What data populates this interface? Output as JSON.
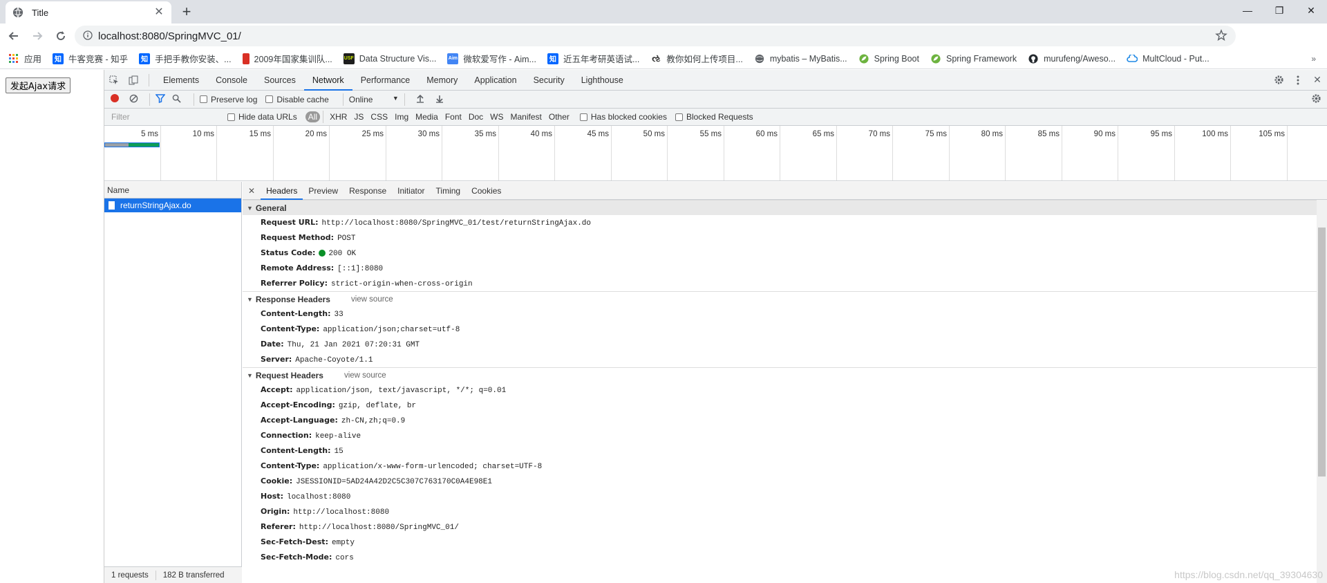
{
  "browser": {
    "tab_title": "Title",
    "url": "localhost:8080/SpringMVC_01/"
  },
  "bookmarks": [
    {
      "label": "应用",
      "icon": "apps-grid-icon",
      "color": "#ea4335"
    },
    {
      "label": "牛客竞赛 - 知乎",
      "icon": "zhihu-icon",
      "color": "#0066ff"
    },
    {
      "label": "手把手教你安装、...",
      "icon": "zhihu-icon",
      "color": "#0066ff"
    },
    {
      "label": "2009年国家集训队...",
      "icon": "pdf-icon",
      "color": "#d93025"
    },
    {
      "label": "Data Structure Vis...",
      "icon": "usf-icon",
      "color": "#1e1e1e"
    },
    {
      "label": "微软爱写作 - Aim...",
      "icon": "aim-icon",
      "color": "#4285f4"
    },
    {
      "label": "近五年考研英语试...",
      "icon": "zhihu-icon",
      "color": "#0066ff"
    },
    {
      "label": "教你如何上传项目...",
      "icon": "github-swirl-icon",
      "color": "#333333"
    },
    {
      "label": "mybatis – MyBatis...",
      "icon": "globe-icon",
      "color": "#5f6368"
    },
    {
      "label": "Spring Boot",
      "icon": "spring-icon",
      "color": "#6db33f"
    },
    {
      "label": "Spring Framework",
      "icon": "spring-icon",
      "color": "#6db33f"
    },
    {
      "label": "murufeng/Aweso...",
      "icon": "github-icon",
      "color": "#24292e"
    },
    {
      "label": "MultCloud - Put...",
      "icon": "cloud-icon",
      "color": "#1e88e5"
    }
  ],
  "page": {
    "button_label": "发起Ajax请求"
  },
  "devtools": {
    "tabs": [
      "Elements",
      "Console",
      "Sources",
      "Network",
      "Performance",
      "Memory",
      "Application",
      "Security",
      "Lighthouse"
    ],
    "active_tab": "Network",
    "toolbar": {
      "preserve_log": "Preserve log",
      "disable_cache": "Disable cache",
      "throttle": "Online"
    },
    "filter": {
      "placeholder": "Filter",
      "hide_data_urls": "Hide data URLs",
      "types": [
        "All",
        "XHR",
        "JS",
        "CSS",
        "Img",
        "Media",
        "Font",
        "Doc",
        "WS",
        "Manifest",
        "Other"
      ],
      "has_blocked_cookies": "Has blocked cookies",
      "blocked_requests": "Blocked Requests"
    },
    "timeline_ticks": [
      "5 ms",
      "10 ms",
      "15 ms",
      "20 ms",
      "25 ms",
      "30 ms",
      "35 ms",
      "40 ms",
      "45 ms",
      "50 ms",
      "55 ms",
      "60 ms",
      "65 ms",
      "70 ms",
      "75 ms",
      "80 ms",
      "85 ms",
      "90 ms",
      "95 ms",
      "100 ms",
      "105 ms",
      "11"
    ],
    "list": {
      "header": "Name",
      "rows": [
        "returnStringAjax.do"
      ],
      "summary_requests": "1 requests",
      "summary_transferred": "182 B transferred"
    },
    "detail_tabs": [
      "Headers",
      "Preview",
      "Response",
      "Initiator",
      "Timing",
      "Cookies"
    ],
    "general": {
      "title": "General",
      "rows": [
        {
          "k": "Request URL:",
          "v": "http://localhost:8080/SpringMVC_01/test/returnStringAjax.do"
        },
        {
          "k": "Request Method:",
          "v": "POST"
        },
        {
          "k": "Status Code:",
          "v": "200 OK"
        },
        {
          "k": "Remote Address:",
          "v": "[::1]:8080"
        },
        {
          "k": "Referrer Policy:",
          "v": "strict-origin-when-cross-origin"
        }
      ]
    },
    "response_headers": {
      "title": "Response Headers",
      "view_source": "view source",
      "rows": [
        {
          "k": "Content-Length:",
          "v": "33"
        },
        {
          "k": "Content-Type:",
          "v": "application/json;charset=utf-8"
        },
        {
          "k": "Date:",
          "v": "Thu, 21 Jan 2021 07:20:31 GMT"
        },
        {
          "k": "Server:",
          "v": "Apache-Coyote/1.1"
        }
      ]
    },
    "request_headers": {
      "title": "Request Headers",
      "view_source": "view source",
      "rows": [
        {
          "k": "Accept:",
          "v": "application/json, text/javascript, */*; q=0.01"
        },
        {
          "k": "Accept-Encoding:",
          "v": "gzip, deflate, br"
        },
        {
          "k": "Accept-Language:",
          "v": "zh-CN,zh;q=0.9"
        },
        {
          "k": "Connection:",
          "v": "keep-alive"
        },
        {
          "k": "Content-Length:",
          "v": "15"
        },
        {
          "k": "Content-Type:",
          "v": "application/x-www-form-urlencoded; charset=UTF-8"
        },
        {
          "k": "Cookie:",
          "v": "JSESSIONID=5AD24A42D2C5C307C763170C0A4E98E1"
        },
        {
          "k": "Host:",
          "v": "localhost:8080"
        },
        {
          "k": "Origin:",
          "v": "http://localhost:8080"
        },
        {
          "k": "Referer:",
          "v": "http://localhost:8080/SpringMVC_01/"
        },
        {
          "k": "Sec-Fetch-Dest:",
          "v": "empty"
        },
        {
          "k": "Sec-Fetch-Mode:",
          "v": "cors"
        }
      ]
    }
  },
  "watermark": "https://blog.csdn.net/qq_39304630"
}
